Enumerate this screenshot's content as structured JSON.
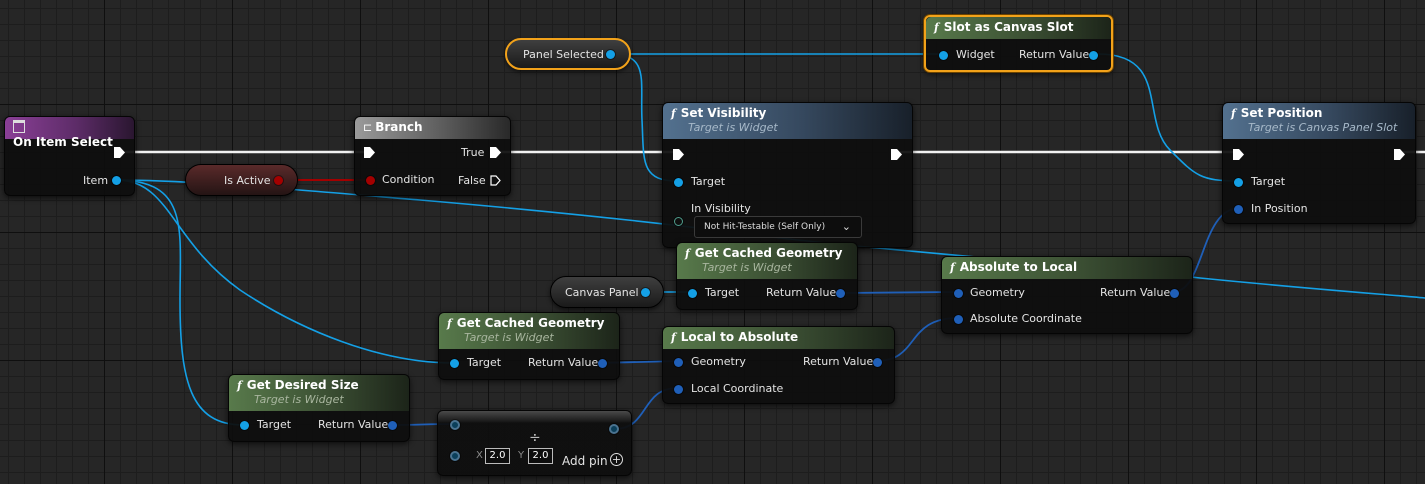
{
  "nodes": {
    "on_item_select": {
      "title": "On Item Select",
      "item_pin": "Item"
    },
    "branch": {
      "title": "Branch",
      "condition": "Condition",
      "true_pin": "True",
      "false_pin": "False"
    },
    "is_active": {
      "label": "Is Active"
    },
    "panel_selected": {
      "label": "Panel Selected"
    },
    "canvas_panel": {
      "label": "Canvas Panel"
    },
    "slot_as_canvas_slot": {
      "title": "Slot as Canvas Slot",
      "in_pin": "Widget",
      "out_pin": "Return Value"
    },
    "set_visibility": {
      "title": "Set Visibility",
      "subtitle": "Target is Widget",
      "target": "Target",
      "in_visibility": "In Visibility",
      "visibility_value": "Not Hit-Testable (Self Only)"
    },
    "set_position": {
      "title": "Set Position",
      "subtitle": "Target is Canvas Panel Slot",
      "target": "Target",
      "in_position": "In Position"
    },
    "get_cached_geometry_1": {
      "title": "Get Cached Geometry",
      "subtitle": "Target is Widget",
      "target": "Target",
      "return": "Return Value"
    },
    "get_cached_geometry_2": {
      "title": "Get Cached Geometry",
      "subtitle": "Target is Widget",
      "target": "Target",
      "return": "Return Value"
    },
    "absolute_to_local": {
      "title": "Absolute to Local",
      "geometry": "Geometry",
      "return": "Return Value",
      "absolute_coordinate": "Absolute Coordinate"
    },
    "local_to_absolute": {
      "title": "Local to Absolute",
      "geometry": "Geometry",
      "return": "Return Value",
      "local_coordinate": "Local Coordinate"
    },
    "get_desired_size": {
      "title": "Get Desired Size",
      "subtitle": "Target is Widget",
      "target": "Target",
      "return": "Return Value"
    },
    "divide": {
      "operator": "÷",
      "x_label": "X",
      "x_value": "2.0",
      "y_label": "Y",
      "y_value": "2.0",
      "add_pin": "Add pin"
    }
  },
  "colors": {
    "exec": "#ffffff",
    "object_pin": "#14a0e6",
    "bool_pin": "#a30000",
    "vector2d_pin": "#1f5fb8",
    "selection": "#f2a21a",
    "function_header": "#587a4b",
    "target_header": "#53718f",
    "event_header": "#8a3f96"
  }
}
